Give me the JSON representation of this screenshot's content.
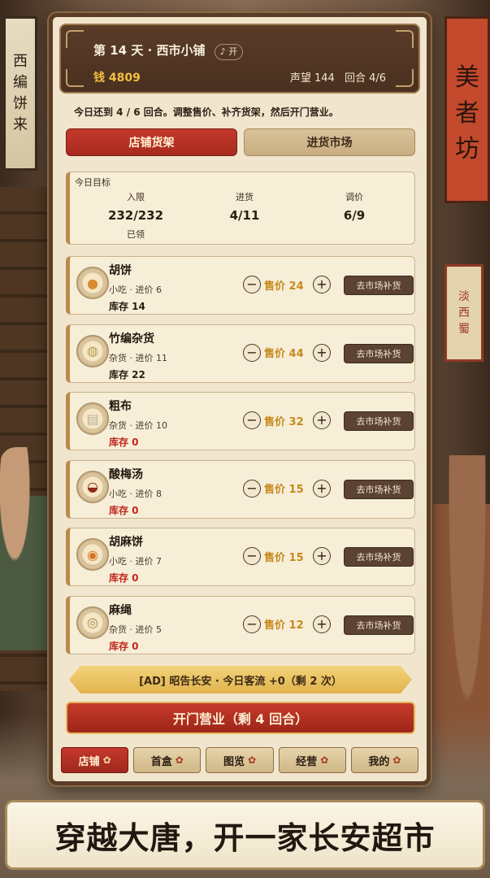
{
  "background": {
    "left_banner": [
      "西",
      "编",
      "饼",
      "来"
    ],
    "right_banner": [
      "美",
      "者",
      "坊"
    ],
    "right_banner2": [
      "淡",
      "西",
      "蜀"
    ]
  },
  "header": {
    "day": "第 14 天",
    "shop": "西市小铺",
    "mode_icon": "music-note-icon",
    "mode_label": "♪ 开",
    "money": "钱 4809",
    "reputation": "声望 144",
    "round": "回合 4/6"
  },
  "notice": "今日还到 4 / 6 回合。调整售价、补齐货架，然后开门营业。",
  "tabs": [
    {
      "label": "店铺货架",
      "active": true
    },
    {
      "label": "进货市场",
      "active": false
    }
  ],
  "goals": {
    "title": "今日目标",
    "cols": [
      {
        "label": "入限",
        "value": "232/232",
        "sub": "已领"
      },
      {
        "label": "进货",
        "value": "4/11",
        "sub": ""
      },
      {
        "label": "调价",
        "value": "6/9",
        "sub": ""
      }
    ]
  },
  "items": [
    {
      "name": "胡饼",
      "meta": "小吃 · 进价 6",
      "stock": "库存 14",
      "stock_zero": false,
      "price": "售价 24",
      "restock": "去市场补货",
      "icon": "flatbread-icon"
    },
    {
      "name": "竹编杂货",
      "meta": "杂货 · 进价 11",
      "stock": "库存 22",
      "stock_zero": false,
      "price": "售价 44",
      "restock": "去市场补货",
      "icon": "bamboo-basket-icon"
    },
    {
      "name": "粗布",
      "meta": "杂货 · 进价 10",
      "stock": "库存 0",
      "stock_zero": true,
      "price": "售价 32",
      "restock": "去市场补货",
      "icon": "cloth-icon"
    },
    {
      "name": "酸梅汤",
      "meta": "小吃 · 进价 8",
      "stock": "库存 0",
      "stock_zero": true,
      "price": "售价 15",
      "restock": "去市场补货",
      "icon": "soup-bowl-icon"
    },
    {
      "name": "胡麻饼",
      "meta": "小吃 · 进价 7",
      "stock": "库存 0",
      "stock_zero": true,
      "price": "售价 15",
      "restock": "去市场补货",
      "icon": "sesame-cake-icon"
    },
    {
      "name": "麻绳",
      "meta": "杂货 · 进价 5",
      "stock": "库存 0",
      "stock_zero": true,
      "price": "售价 12",
      "restock": "去市场补货",
      "icon": "rope-icon"
    }
  ],
  "ad_bar": "[AD] 昭告长安 · 今日客流 +0（剩 2 次）",
  "open_button": "开门营业（剩 4 回合）",
  "nav": [
    {
      "label": "店铺",
      "active": true
    },
    {
      "label": "首盒",
      "active": false
    },
    {
      "label": "图览",
      "active": false
    },
    {
      "label": "经营",
      "active": false
    },
    {
      "label": "我的",
      "active": false
    }
  ],
  "slogan": "穿越大唐，开一家长安超市",
  "colors": {
    "accent_red": "#c4392b",
    "gold": "#c58a1c",
    "panel_bg": "#f1e6cd",
    "header_bg": "#4a3020",
    "stock_zero": "#c0271d"
  }
}
